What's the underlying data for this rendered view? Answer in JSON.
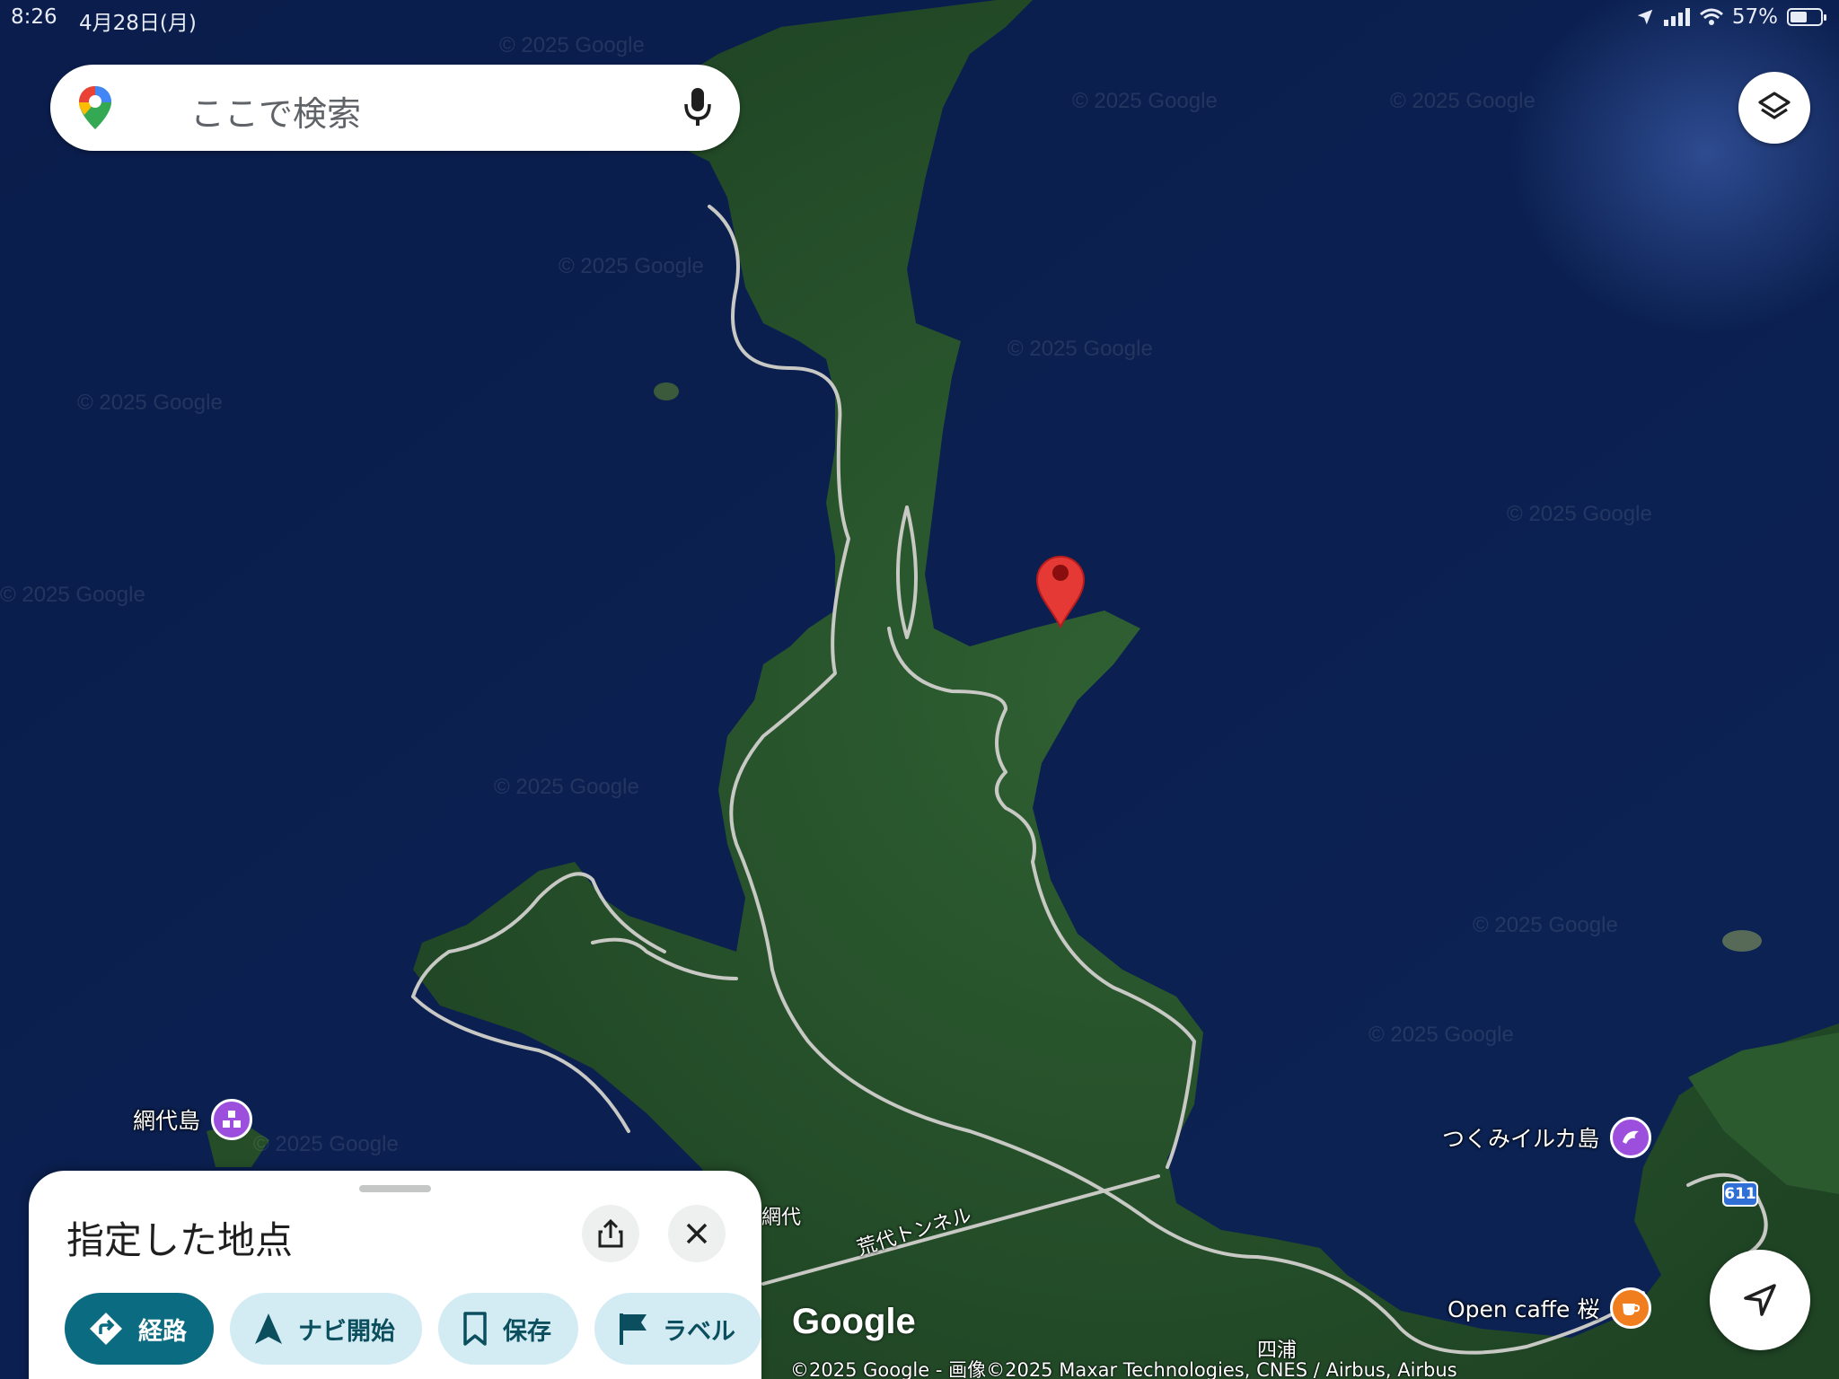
{
  "status_bar": {
    "time": "8:26",
    "date": "4月28日(月)",
    "battery": "57%",
    "battery_level": 0.57
  },
  "search": {
    "placeholder": "ここで検索"
  },
  "map": {
    "pois": [
      {
        "name": "網代島",
        "icon": "landmark-icon",
        "color": "#9c4fdc"
      },
      {
        "name": "つくみイルカ島",
        "icon": "dolphin-icon",
        "color": "#9c4fdc"
      },
      {
        "name": "Open caffe 桜",
        "icon": "coffee-icon",
        "color": "#f07d1e"
      }
    ],
    "labels": {
      "ajiro": "網代",
      "tunnel": "荒代トンネル",
      "youra": "四浦"
    },
    "route_number": "611",
    "watermark": "© 2025 Google",
    "logo": "Google",
    "attribution": "©2025 Google - 画像©2025 Maxar Technologies, CNES / Airbus, Airbus"
  },
  "sheet": {
    "title": "指定した地点",
    "actions": [
      {
        "label": "経路",
        "icon": "directions-icon",
        "style": "primary"
      },
      {
        "label": "ナビ開始",
        "icon": "navigation-arrow-icon",
        "style": "secondary"
      },
      {
        "label": "保存",
        "icon": "bookmark-icon",
        "style": "secondary"
      },
      {
        "label": "ラベル",
        "icon": "flag-icon",
        "style": "secondary"
      }
    ]
  },
  "colors": {
    "sea": "#0b1f4f",
    "land": "#2c5a2f",
    "pin": "#e53935",
    "primary_chip": "#0b6b80",
    "secondary_chip": "#d3ecf4"
  }
}
